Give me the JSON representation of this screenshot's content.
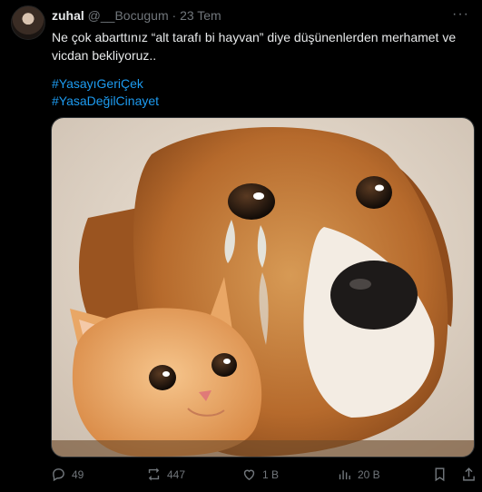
{
  "author": {
    "name": "zuhal",
    "handle": "@__Bocugum",
    "separator": "·",
    "date": "23 Tem"
  },
  "tweet": {
    "text": "Ne çok abarttınız “alt tarafı bi hayvan” diye düşünenlerden merhamet ve vicdan bekliyoruz..",
    "hashtags": [
      "#YasayıGeriÇek",
      "#YasaDeğilCinayet"
    ]
  },
  "media": {
    "description_icon": "photo-crying-dog-and-kitten"
  },
  "actions": {
    "replies": "49",
    "retweets": "447",
    "likes": "1 B",
    "views": "20 B"
  },
  "colors": {
    "accent": "#1d9bf0",
    "muted": "#71767b",
    "text": "#e7e9ea",
    "background": "#000000"
  }
}
